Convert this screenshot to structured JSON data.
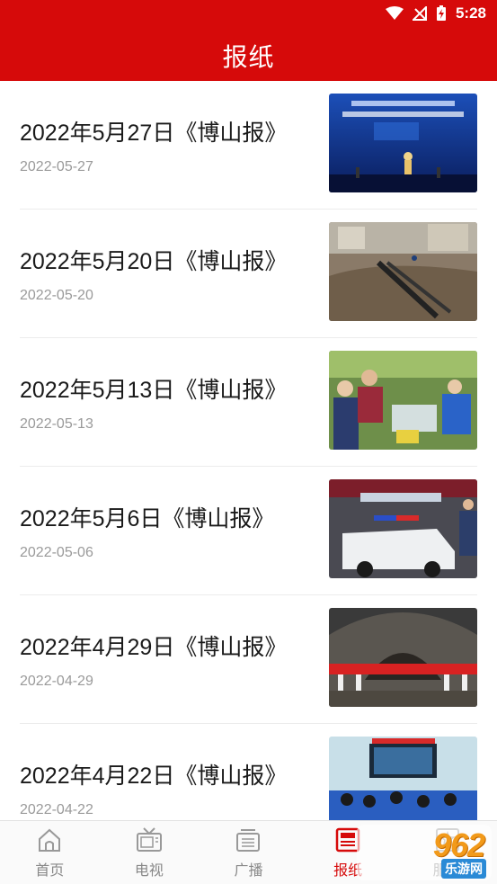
{
  "status_bar": {
    "time": "5:28"
  },
  "header": {
    "title": "报纸"
  },
  "articles": [
    {
      "title": "2022年5月27日《博山报》",
      "date": "2022-05-27"
    },
    {
      "title": "2022年5月20日《博山报》",
      "date": "2022-05-20"
    },
    {
      "title": "2022年5月13日《博山报》",
      "date": "2022-05-13"
    },
    {
      "title": "2022年5月6日《博山报》",
      "date": "2022-05-06"
    },
    {
      "title": "2022年4月29日《博山报》",
      "date": "2022-04-29"
    },
    {
      "title": "2022年4月22日《博山报》",
      "date": "2022-04-22"
    }
  ],
  "tabs": [
    {
      "label": "首页",
      "icon": "home-icon"
    },
    {
      "label": "电视",
      "icon": "tv-icon"
    },
    {
      "label": "广播",
      "icon": "radio-icon"
    },
    {
      "label": "报纸",
      "icon": "newspaper-icon",
      "active": true
    },
    {
      "label": "服务",
      "icon": "service-icon"
    }
  ],
  "watermark": {
    "logo": "962",
    "sub": "乐游网"
  },
  "colors": {
    "brand_red": "#d60a0a",
    "tab_inactive": "#888888"
  }
}
